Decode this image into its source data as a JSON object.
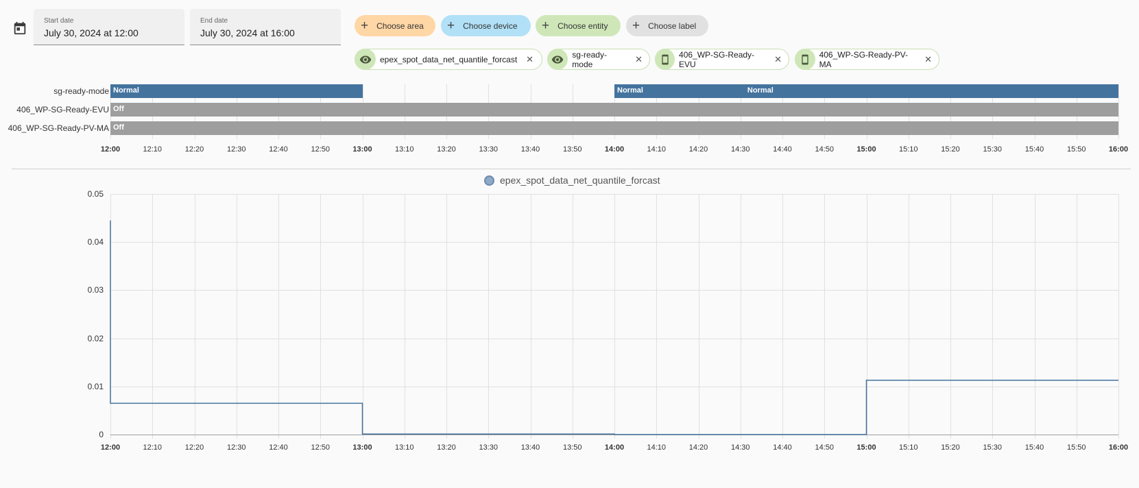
{
  "date_range": {
    "start_label": "Start date",
    "start_value": "July 30, 2024 at 12:00",
    "end_label": "End date",
    "end_value": "July 30, 2024 at 16:00"
  },
  "target_buttons": [
    {
      "label": "Choose area",
      "color": "#ffd6a5"
    },
    {
      "label": "Choose device",
      "color": "#b1e0f7"
    },
    {
      "label": "Choose entity",
      "color": "#cfe7b8"
    },
    {
      "label": "Choose label",
      "color": "#e1e1e1"
    }
  ],
  "selected_targets": [
    {
      "label": "epex_spot_data_net_quantile_forcast",
      "icon": "eye-icon"
    },
    {
      "label": "sg-ready-mode",
      "icon": "eye-icon"
    },
    {
      "label": "406_WP-SG-Ready-EVU",
      "icon": "cellphone-icon"
    },
    {
      "label": "406_WP-SG-Ready-PV-MA",
      "icon": "cellphone-icon"
    }
  ],
  "timeline": {
    "rows": [
      {
        "name": "sg-ready-mode",
        "segments": [
          {
            "start": "12:00",
            "end": "13:00",
            "state": "Normal",
            "color": "#44739e"
          },
          {
            "start": "14:00",
            "end": "14:31",
            "state": "Normal",
            "color": "#44739e"
          },
          {
            "start": "14:31",
            "end": "16:00",
            "state": "Normal",
            "color": "#44739e"
          }
        ]
      },
      {
        "name": "406_WP-SG-Ready-EVU",
        "segments": [
          {
            "start": "12:00",
            "end": "16:00",
            "state": "Off",
            "color": "#9e9e9e"
          }
        ]
      },
      {
        "name": "406_WP-SG-Ready-PV-MA",
        "segments": [
          {
            "start": "12:00",
            "end": "16:00",
            "state": "Off",
            "color": "#9e9e9e"
          }
        ]
      }
    ]
  },
  "time_ticks": [
    "12:00",
    "12:10",
    "12:20",
    "12:30",
    "12:40",
    "12:50",
    "13:00",
    "13:10",
    "13:20",
    "13:30",
    "13:40",
    "13:50",
    "14:00",
    "14:10",
    "14:20",
    "14:30",
    "14:40",
    "14:50",
    "15:00",
    "15:10",
    "15:20",
    "15:30",
    "15:40",
    "15:50",
    "16:00"
  ],
  "chart_data": {
    "type": "line",
    "step": true,
    "series": [
      {
        "name": "epex_spot_data_net_quantile_forcast",
        "color": "#44739e",
        "points": [
          {
            "x": "12:00",
            "y": 0.0445
          },
          {
            "x": "12:00",
            "y": 0.0065
          },
          {
            "x": "13:00",
            "y": 0.0065
          },
          {
            "x": "13:00",
            "y": 0.0001
          },
          {
            "x": "14:00",
            "y": 0.0001
          },
          {
            "x": "14:00",
            "y": 0.0
          },
          {
            "x": "15:00",
            "y": 0.0
          },
          {
            "x": "15:00",
            "y": 0.0113
          },
          {
            "x": "16:00",
            "y": 0.0113
          }
        ]
      }
    ],
    "x_range": [
      "12:00",
      "16:00"
    ],
    "ylim": [
      0,
      0.05
    ],
    "y_ticks": [
      "0",
      "0.01",
      "0.02",
      "0.03",
      "0.04",
      "0.05"
    ],
    "grid": true,
    "legend": "top-center"
  }
}
